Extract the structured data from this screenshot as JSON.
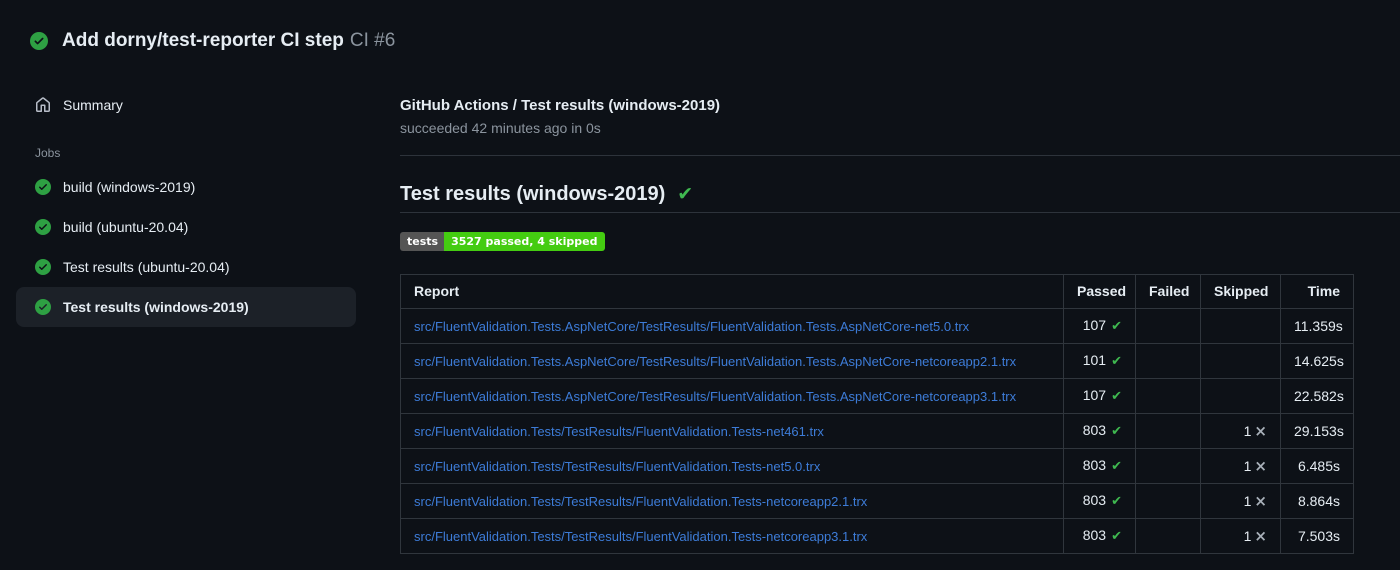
{
  "colors": {
    "page_background": "#0d1117",
    "selected_item_background": "#1c2128",
    "success_green": "#2ea043",
    "check_glyph_green": "#3fb950",
    "link_blue": "#3d7cd8",
    "muted_text": "#8b949e",
    "border": "#30363d",
    "badge_label_bg": "#555555",
    "badge_value_bg": "#44cc11"
  },
  "icons": {
    "check": "✔",
    "cross": "×"
  },
  "run_header": {
    "status": "success",
    "title": "Add dorny/test-reporter CI step",
    "run_number": "CI #6"
  },
  "sidebar": {
    "summary_label": "Summary",
    "jobs_label": "Jobs",
    "jobs": [
      {
        "label": "build (windows-2019)",
        "status": "success",
        "selected": false
      },
      {
        "label": "build (ubuntu-20.04)",
        "status": "success",
        "selected": false
      },
      {
        "label": "Test results (ubuntu-20.04)",
        "status": "success",
        "selected": false
      },
      {
        "label": "Test results (windows-2019)",
        "status": "success",
        "selected": true
      }
    ]
  },
  "main": {
    "check_name": "GitHub Actions / Test results (windows-2019)",
    "check_status": "succeeded 42 minutes ago in 0s",
    "section_title": "Test results (windows-2019)",
    "badge": {
      "label": "tests",
      "value": "3527 passed, 4 skipped"
    },
    "table": {
      "headers": [
        "Report",
        "Passed",
        "Failed",
        "Skipped",
        "Time"
      ],
      "rows": [
        {
          "report": "src/FluentValidation.Tests.AspNetCore/TestResults/FluentValidation.Tests.AspNetCore-net5.0.trx",
          "passed": "107",
          "failed": "",
          "skipped": "",
          "time": "11.359s"
        },
        {
          "report": "src/FluentValidation.Tests.AspNetCore/TestResults/FluentValidation.Tests.AspNetCore-netcoreapp2.1.trx",
          "passed": "101",
          "failed": "",
          "skipped": "",
          "time": "14.625s"
        },
        {
          "report": "src/FluentValidation.Tests.AspNetCore/TestResults/FluentValidation.Tests.AspNetCore-netcoreapp3.1.trx",
          "passed": "107",
          "failed": "",
          "skipped": "",
          "time": "22.582s"
        },
        {
          "report": "src/FluentValidation.Tests/TestResults/FluentValidation.Tests-net461.trx",
          "passed": "803",
          "failed": "",
          "skipped": "1",
          "time": "29.153s"
        },
        {
          "report": "src/FluentValidation.Tests/TestResults/FluentValidation.Tests-net5.0.trx",
          "passed": "803",
          "failed": "",
          "skipped": "1",
          "time": "6.485s"
        },
        {
          "report": "src/FluentValidation.Tests/TestResults/FluentValidation.Tests-netcoreapp2.1.trx",
          "passed": "803",
          "failed": "",
          "skipped": "1",
          "time": "8.864s"
        },
        {
          "report": "src/FluentValidation.Tests/TestResults/FluentValidation.Tests-netcoreapp3.1.trx",
          "passed": "803",
          "failed": "",
          "skipped": "1",
          "time": "7.503s"
        }
      ]
    }
  }
}
